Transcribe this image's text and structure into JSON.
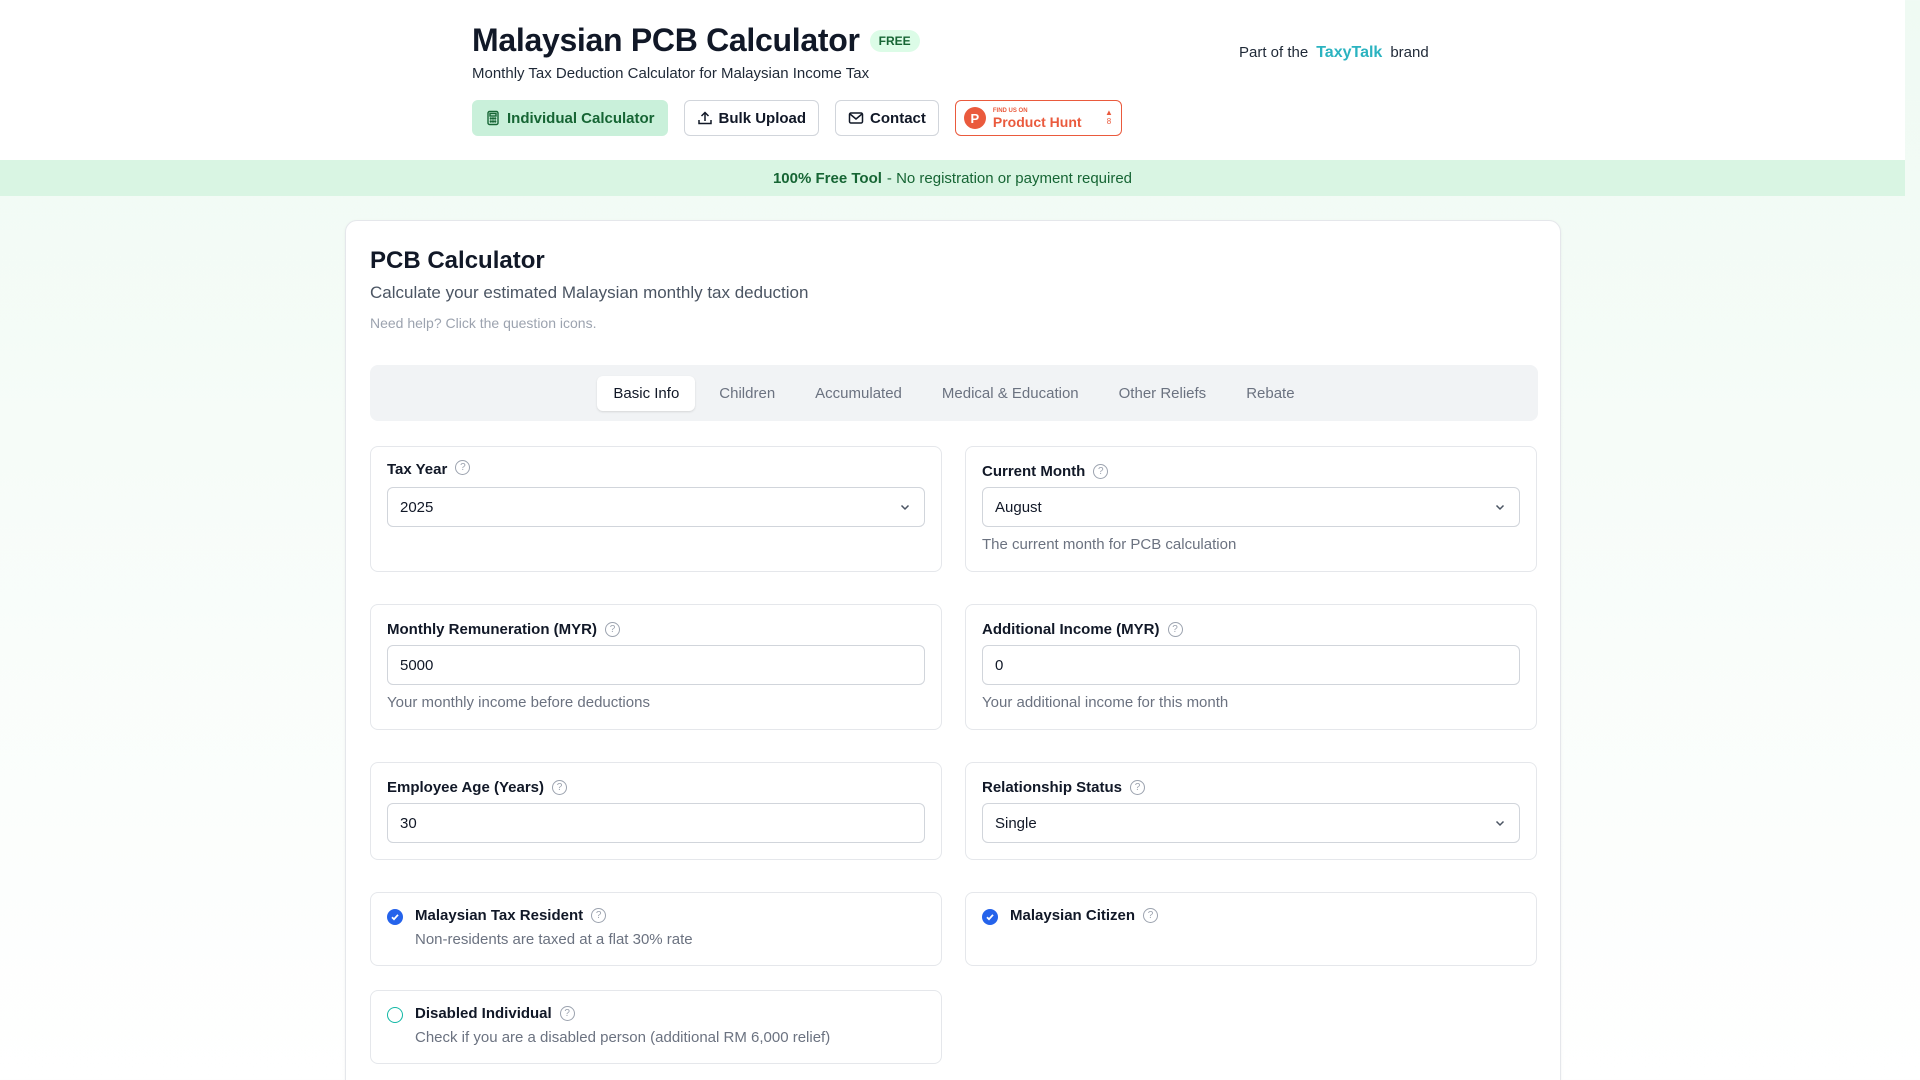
{
  "header": {
    "title": "Malaysian PCB Calculator",
    "badge": "FREE",
    "subtitle": "Monthly Tax Deduction Calculator for Malaysian Income Tax",
    "brand_prefix": "Part of the",
    "brand_name": "TaxyTalk",
    "brand_suffix": "brand"
  },
  "nav": {
    "individual": "Individual Calculator",
    "bulk": "Bulk Upload",
    "contact": "Contact",
    "product_hunt_small": "FIND US ON",
    "product_hunt_big": "Product Hunt",
    "product_hunt_votes": "8"
  },
  "banner": {
    "bold": "100% Free Tool",
    "text": "- No registration or payment required"
  },
  "card": {
    "title": "PCB Calculator",
    "description": "Calculate your estimated Malaysian monthly tax deduction",
    "help": "Need help? Click the question icons."
  },
  "tabs": [
    {
      "label": "Basic Info",
      "active": true
    },
    {
      "label": "Children",
      "active": false
    },
    {
      "label": "Accumulated",
      "active": false
    },
    {
      "label": "Medical & Education",
      "active": false
    },
    {
      "label": "Other Reliefs",
      "active": false
    },
    {
      "label": "Rebate",
      "active": false
    }
  ],
  "fields": {
    "tax_year": {
      "label": "Tax Year",
      "value": "2025"
    },
    "current_month": {
      "label": "Current Month",
      "value": "August",
      "hint": "The current month for PCB calculation"
    },
    "monthly_remuneration": {
      "label": "Monthly Remuneration (MYR)",
      "value": "5000",
      "hint": "Your monthly income before deductions"
    },
    "additional_income": {
      "label": "Additional Income (MYR)",
      "value": "0",
      "hint": "Your additional income for this month"
    },
    "employee_age": {
      "label": "Employee Age (Years)",
      "value": "30"
    },
    "relationship_status": {
      "label": "Relationship Status",
      "value": "Single"
    }
  },
  "checks": {
    "tax_resident": {
      "label": "Malaysian Tax Resident",
      "hint": "Non-residents are taxed at a flat 30% rate",
      "checked": true
    },
    "citizen": {
      "label": "Malaysian Citizen",
      "checked": true
    },
    "disabled": {
      "label": "Disabled Individual",
      "hint": "Check if you are a disabled person (additional RM 6,000 relief)",
      "checked": false
    }
  },
  "colors": {
    "accent_green": "#166534",
    "active_tab_bg": "#c9f0da",
    "brand_teal": "#2bb3c0",
    "product_hunt": "#ea5a3d",
    "checkbox_blue": "#2563eb"
  }
}
